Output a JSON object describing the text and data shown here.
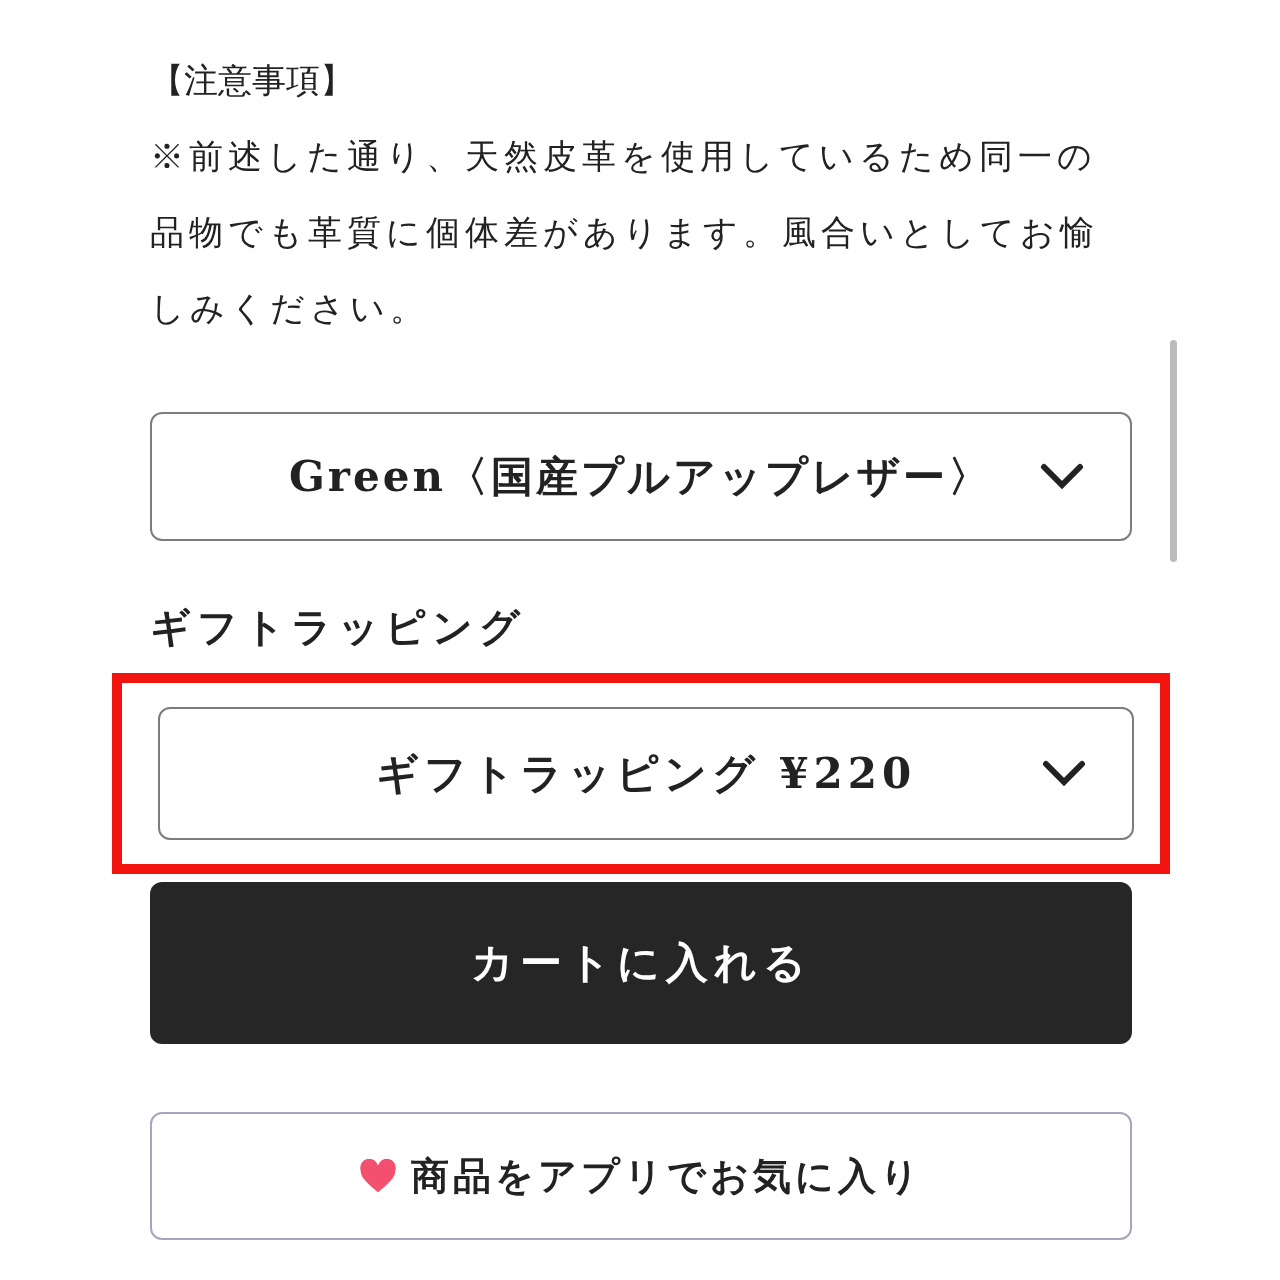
{
  "notice": {
    "heading": "【注意事項】",
    "body": "※前述した通り、天然皮革を使用しているため同一の品物でも革質に個体差があります。風合いとしてお愉しみください。"
  },
  "color_select": {
    "value": "Green〈国産プルアップレザー〉"
  },
  "gift": {
    "label": "ギフトラッピング",
    "select": {
      "value": "ギフトラッピング ¥220",
      "highlighted": true
    }
  },
  "add_to_cart": {
    "label": "カートに入れる"
  },
  "favorite": {
    "label": "商品をアプリでお気に入り"
  }
}
